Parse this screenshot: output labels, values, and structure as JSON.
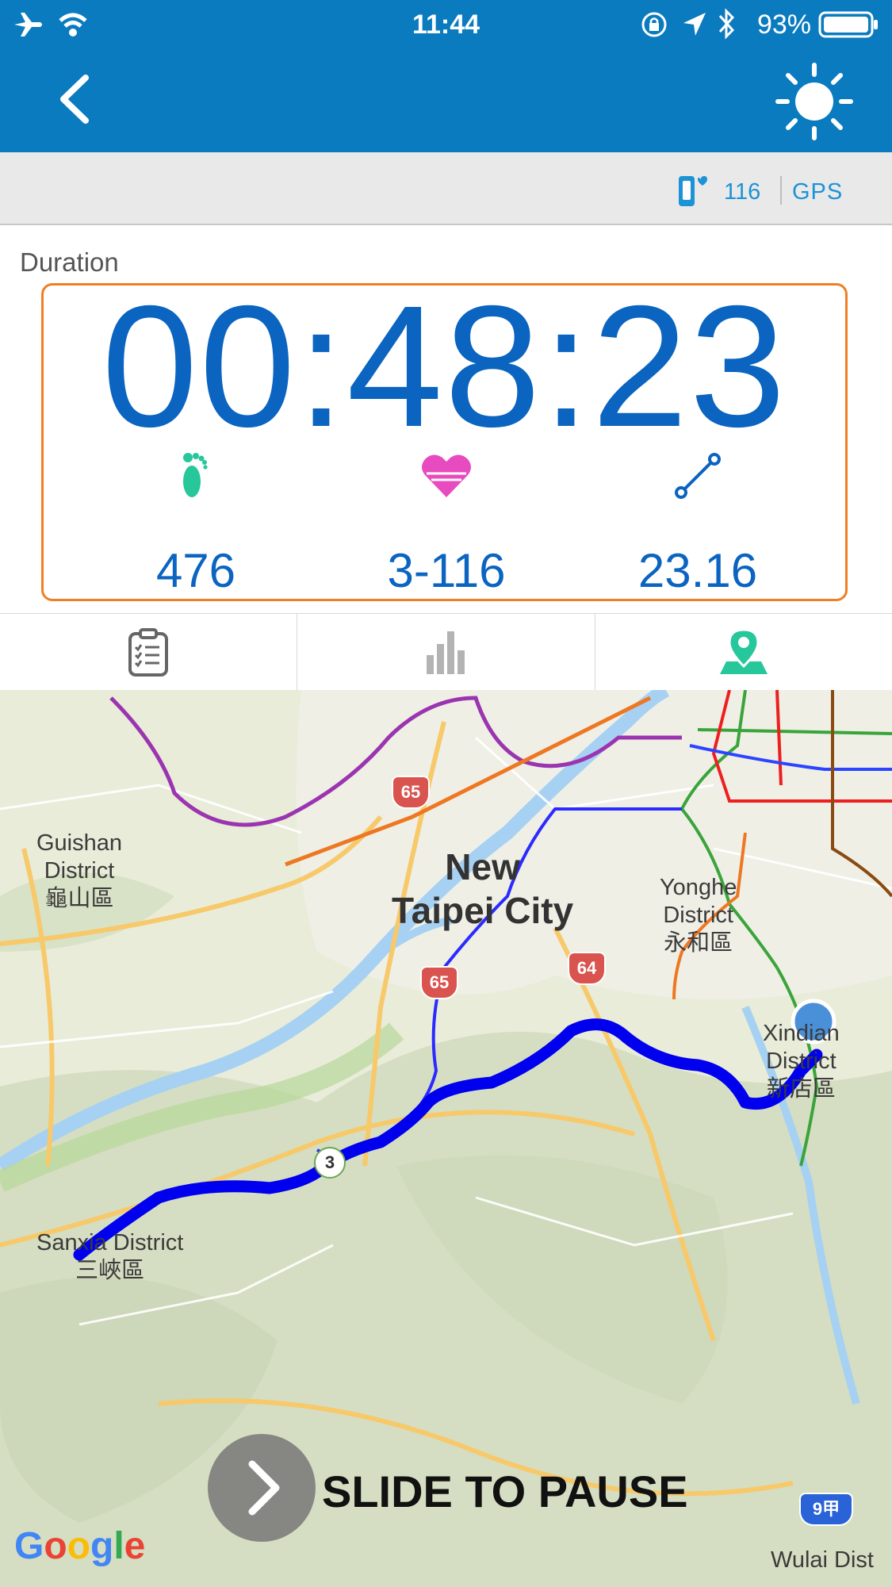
{
  "status_bar": {
    "time": "11:44",
    "battery": "93%"
  },
  "nav": {
    "back_icon": "chevron-left-icon",
    "brightness_icon": "sun-icon"
  },
  "device": {
    "hr_value": "116",
    "gps_label": "GPS"
  },
  "workout": {
    "duration_label": "Duration",
    "duration": "00:48:23",
    "steps": "476",
    "heart_rate": "3-116",
    "distance": "23.16"
  },
  "tabs": [
    {
      "name": "summary",
      "icon": "clipboard-icon"
    },
    {
      "name": "charts",
      "icon": "bar-chart-icon"
    },
    {
      "name": "map",
      "icon": "map-pin-icon",
      "active": true
    }
  ],
  "map": {
    "labels": {
      "guishan": "Guishan District 龜山區",
      "guishan_l1": "Guishan",
      "guishan_l2": "District",
      "guishan_l3": "龜山區",
      "ntc_l1": "New",
      "ntc_l2": "Taipei City",
      "yonghe_l1": "Yonghe",
      "yonghe_l2": "District",
      "yonghe_l3": "永和區",
      "xindian_l1": "Xindian",
      "xindian_l2": "District",
      "xindian_l3": "新店區",
      "sanxia_l1": "Sanxia District",
      "sanxia_l2": "三峽區",
      "wulai": "Wulai Dist"
    },
    "shields": [
      "65",
      "65",
      "64",
      "3",
      "9甲"
    ],
    "attribution": "Google"
  },
  "slide": {
    "label": "SLIDE TO PAUSE"
  },
  "colors": {
    "nav": "#0a7bbf",
    "timer": "#0a64c0",
    "accent": "#f07f23",
    "route": "#0000ee"
  }
}
